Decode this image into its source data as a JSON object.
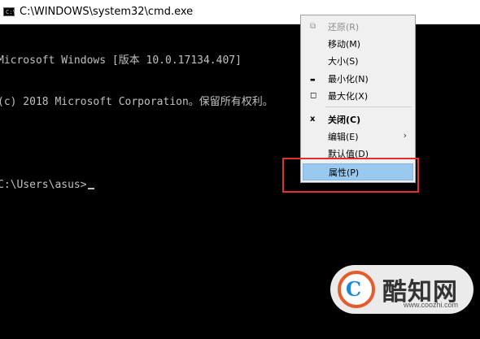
{
  "window": {
    "title": "C:\\WINDOWS\\system32\\cmd.exe",
    "icon_glyph": "C:\\",
    "icon": "console-icon"
  },
  "console": {
    "lines": [
      "Microsoft Windows [版本 10.0.17134.407]",
      "(c) 2018 Microsoft Corporation。保留所有权利。",
      "",
      "C:\\Users\\asus>"
    ]
  },
  "context_menu": {
    "items": [
      {
        "label": "还原(R)",
        "icon": "restore-icon",
        "glyph": "⧉",
        "enabled": false
      },
      {
        "label": "移动(M)",
        "enabled": true
      },
      {
        "label": "大小(S)",
        "enabled": true
      },
      {
        "label": "最小化(N)",
        "icon": "minimize-icon",
        "glyph": "▬",
        "enabled": true
      },
      {
        "label": "最大化(X)",
        "icon": "maximize-icon",
        "glyph": "◻",
        "enabled": true
      },
      {
        "label": "关闭(C)",
        "icon": "close-icon",
        "glyph": "x",
        "enabled": true,
        "bold": true
      },
      {
        "label": "编辑(E)",
        "submenu": true,
        "enabled": true
      },
      {
        "label": "默认值(D)",
        "enabled": true
      },
      {
        "label": "属性(P)",
        "enabled": true,
        "highlighted": true
      }
    ],
    "submenu_arrow": "›",
    "highlight_color": "#99c9ef"
  },
  "annotation": {
    "color": "#e0312b"
  },
  "watermark": {
    "logo_glyph": "C",
    "name": "酷知网",
    "url": "www.coozhi.com"
  }
}
